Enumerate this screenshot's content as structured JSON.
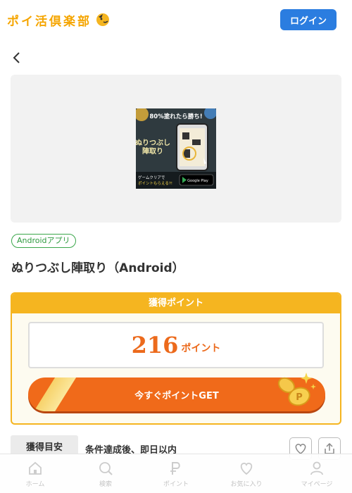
{
  "header": {
    "logo_text": "ポイ活倶楽部",
    "login_label": "ログイン"
  },
  "colors": {
    "accent": "#2b7de0",
    "gold": "#f5b520",
    "orange": "#f06a1a",
    "green": "#3aa64a"
  },
  "banner": {
    "headline": "80%塗れたら勝ち!",
    "game_title_line1": "ぬりつぶし",
    "game_title_line2": "陣取り",
    "footer_line1": "ゲームクリアで",
    "footer_line2": "ポイントもらえる?!",
    "store_badge": "Google Play"
  },
  "offer": {
    "tag": "Androidアプリ",
    "title": "ぬりつぶし陣取り（Android）"
  },
  "points": {
    "header": "獲得ポイント",
    "value": "216",
    "unit": "ポイント",
    "cta": "今すぐポイントGET"
  },
  "estimate": {
    "label": "獲得目安",
    "value": "条件達成後、即日以内"
  },
  "bottom_nav": [
    {
      "label": "ホーム",
      "icon": "home-icon"
    },
    {
      "label": "検索",
      "icon": "search-icon"
    },
    {
      "label": "ポイント",
      "icon": "point-icon"
    },
    {
      "label": "お気に入り",
      "icon": "heart-icon"
    },
    {
      "label": "マイページ",
      "icon": "user-icon"
    }
  ]
}
